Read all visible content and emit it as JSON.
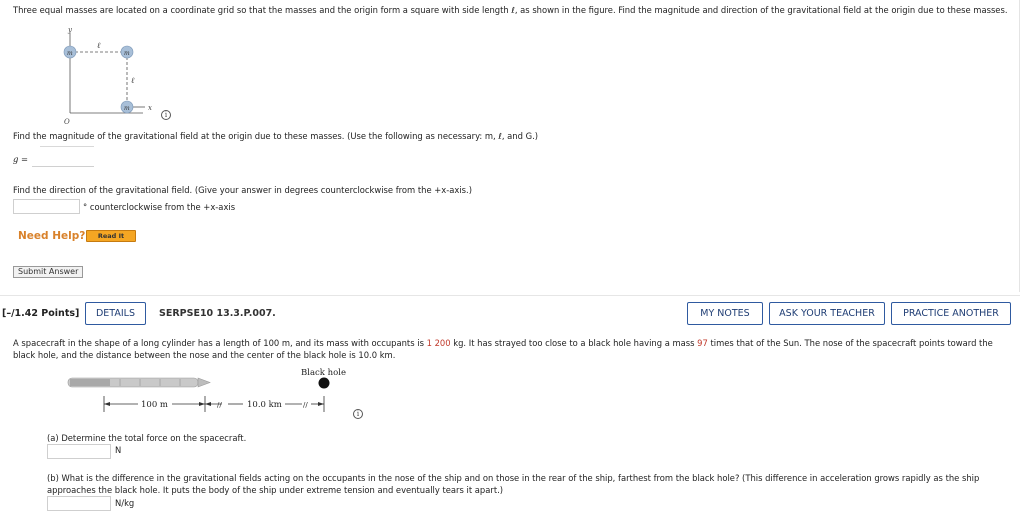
{
  "q1": {
    "intro": "Three equal masses are located on a coordinate grid so that the masses and the origin form a square with side length ℓ, as shown in the figure. Find the magnitude and direction of the gravitational field at the origin due to these masses.",
    "figure": {
      "y_label": "y",
      "x_label": "x",
      "origin_label": "O",
      "mass_label": "m",
      "side_label": "ℓ"
    },
    "magnitude_prompt": "Find the magnitude of the gravitational field at the origin due to these masses. (Use the following as necessary: m, ℓ, and G.)",
    "g_label": "g =",
    "g_value": "",
    "direction_prompt": "Find the direction of the gravitational field. (Give your answer in degrees counterclockwise from the +x-axis.)",
    "direction_value": "",
    "direction_unit": "° counterclockwise from the +x-axis",
    "need_help": "Need Help?",
    "read_it": "Read It",
    "submit": "Submit Answer"
  },
  "q2": {
    "points": "[–/1.42 Points]",
    "details": "DETAILS",
    "code": "SERPSE10 13.3.P.007.",
    "my_notes": "MY NOTES",
    "ask_teacher": "ASK YOUR TEACHER",
    "practice": "PRACTICE ANOTHER",
    "text_a": "A spacecraft in the shape of a long cylinder has a length of 100 m, and its mass with occupants is ",
    "mass_value": "1 200",
    "text_b": " kg. It has strayed too close to a black hole having a mass ",
    "ratio_value": "97",
    "text_c": " times that of the Sun. The nose of the spacecraft points toward the",
    "text_line2": "black hole, and the distance between the nose and the center of the black hole is 10.0 km.",
    "figure": {
      "black_hole_label": "Black hole",
      "length_label": "100 m",
      "distance_label": "10.0 km"
    },
    "part_a": "(a) Determine the total force on the spacecraft.",
    "part_a_value": "",
    "part_a_unit": "N",
    "part_b_line1": "(b) What is the difference in the gravitational fields acting on the occupants in the nose of the ship and on those in the rear of the ship, farthest from the black hole? (This difference in acceleration grows rapidly as the ship",
    "part_b_line2": "approaches the black hole. It puts the body of the ship under extreme tension and eventually tears it apart.)",
    "part_b_value": "",
    "part_b_unit": "N/kg"
  },
  "colors": {
    "accent": "#2f5aa0",
    "help": "#d9822b",
    "read_it_bg": "#f5a623",
    "mass_fill": "#a8bfd8",
    "highlight_value": "#c0392b"
  }
}
